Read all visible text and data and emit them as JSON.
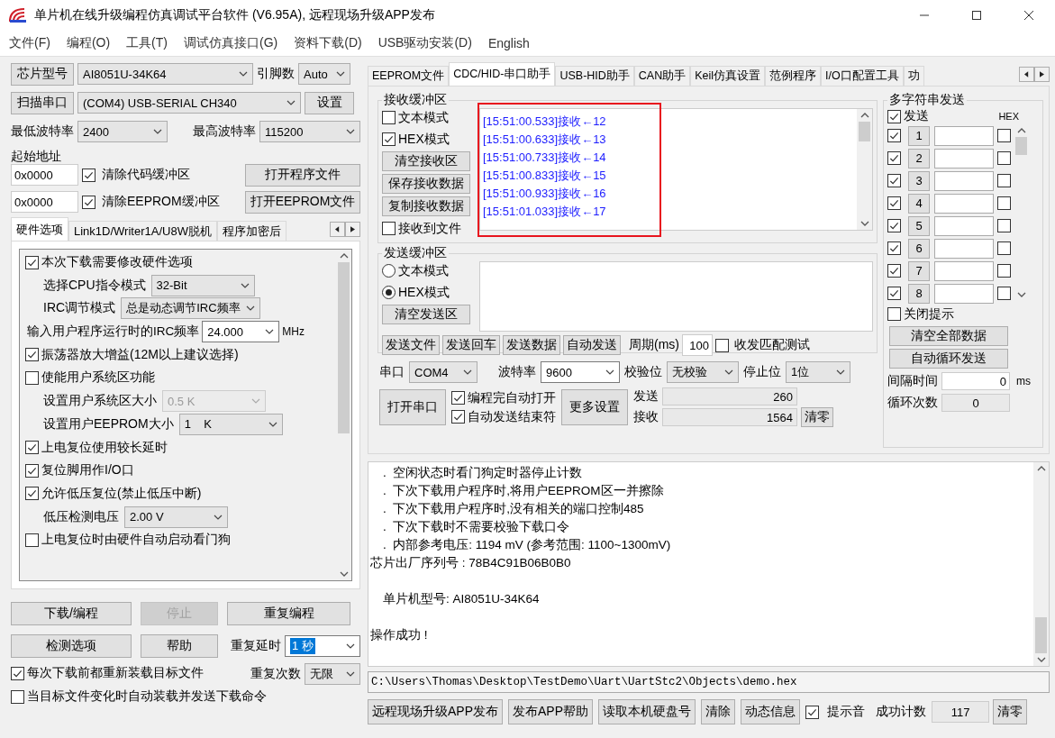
{
  "window": {
    "title": "单片机在线升级编程仿真调试平台软件 (V6.95A), 远程现场升级APP发布"
  },
  "menu": [
    "文件(F)",
    "编程(O)",
    "工具(T)",
    "调试仿真接口(G)",
    "资料下载(D)",
    "USB驱动安装(D)",
    "English"
  ],
  "chip": {
    "button": "芯片型号",
    "value": "AI8051U-34K64",
    "pins_label": "引脚数",
    "pins_value": "Auto"
  },
  "port": {
    "button": "扫描串口",
    "value": "(COM4) USB-SERIAL CH340",
    "settings_button": "设置"
  },
  "baud": {
    "min_label": "最低波特率",
    "min_value": "2400",
    "max_label": "最高波特率",
    "max_value": "115200"
  },
  "start_address": {
    "label": "起始地址",
    "rows": [
      {
        "value": "0x0000",
        "option": "清除代码缓冲区",
        "checked": true,
        "button": "打开程序文件"
      },
      {
        "value": "0x0000",
        "option": "清除EEPROM缓冲区",
        "checked": true,
        "button": "打开EEPROM文件"
      }
    ]
  },
  "left_tabs": [
    {
      "label": "硬件选项",
      "selected": true
    },
    {
      "label": "Link1D/Writer1A/U8W脱机",
      "selected": false
    },
    {
      "label": "程序加密后",
      "selected": false
    }
  ],
  "hardware_options": [
    {
      "kind": "checkbox",
      "label": "本次下载需要修改硬件选项",
      "checked": true
    },
    {
      "kind": "select",
      "label": "选择CPU指令模式",
      "value": "32-Bit",
      "disabled": false
    },
    {
      "kind": "select",
      "label": "IRC调节模式",
      "value": "总是动态调节IRC频率",
      "disabled": false
    },
    {
      "kind": "combo",
      "label": "输入用户程序运行时的IRC频率",
      "value": "24.000",
      "unit": "MHz"
    },
    {
      "kind": "checkbox",
      "label": "振荡器放大增益(12M以上建议选择)",
      "checked": true
    },
    {
      "kind": "checkbox",
      "label": "使能用户系统区功能",
      "checked": false
    },
    {
      "kind": "select",
      "label": "设置用户系统区大小",
      "value": "0.5 K",
      "disabled": true
    },
    {
      "kind": "select",
      "label": "设置用户EEPROM大小",
      "value": "1    K",
      "disabled": false
    },
    {
      "kind": "checkbox",
      "label": "上电复位使用较长延时",
      "checked": true
    },
    {
      "kind": "checkbox",
      "label": "复位脚用作I/O口",
      "checked": true
    },
    {
      "kind": "checkbox",
      "label": "允许低压复位(禁止低压中断)",
      "checked": true
    },
    {
      "kind": "select",
      "label": "低压检测电压",
      "value": "2.00 V",
      "disabled": false
    },
    {
      "kind": "checkbox",
      "label": "上电复位时由硬件自动启动看门狗",
      "checked": false
    }
  ],
  "actions": [
    {
      "label": "下载/编程",
      "disabled": false
    },
    {
      "label": "停止",
      "disabled": true
    },
    {
      "label": "重复编程",
      "disabled": false
    },
    {
      "label": "检测选项",
      "disabled": false
    },
    {
      "label": "帮助",
      "disabled": false
    }
  ],
  "repeat_delay": {
    "label": "重复延时",
    "value": "1 秒",
    "highlighted": true
  },
  "repeat_count": {
    "label": "重复次数",
    "value": "无限"
  },
  "bottom_options": [
    {
      "label": "每次下载前都重新装载目标文件",
      "checked": true
    },
    {
      "label": "当目标文件变化时自动装载并发送下载命令",
      "checked": false
    }
  ],
  "right_tabs": [
    {
      "label": "EEPROM文件",
      "selected": false
    },
    {
      "label": "CDC/HID-串口助手",
      "selected": true
    },
    {
      "label": "USB-HID助手",
      "selected": false
    },
    {
      "label": "CAN助手",
      "selected": false
    },
    {
      "label": "Keil仿真设置",
      "selected": false
    },
    {
      "label": "范例程序",
      "selected": false
    },
    {
      "label": "I/O口配置工具",
      "selected": false
    },
    {
      "label": "功",
      "selected": false
    }
  ],
  "receive": {
    "title": "接收缓冲区",
    "modes": [
      {
        "label": "文本模式",
        "checked": false
      },
      {
        "label": "HEX模式",
        "checked": true
      }
    ],
    "buttons": [
      "清空接收区",
      "保存接收数据",
      "复制接收数据"
    ],
    "to_file": {
      "label": "接收到文件",
      "checked": false
    },
    "highlighted": true,
    "lines": [
      "[15:51:00.533]接收←12",
      "[15:51:00.633]接收←13",
      "[15:51:00.733]接收←14",
      "[15:51:00.833]接收←15",
      "[15:51:00.933]接收←16",
      "[15:51:01.033]接收←17"
    ]
  },
  "send": {
    "title": "发送缓冲区",
    "modes": [
      {
        "label": "文本模式",
        "selected": false
      },
      {
        "label": "HEX模式",
        "selected": true
      }
    ],
    "clear_button": "清空发送区",
    "buttons": [
      "发送文件",
      "发送回车",
      "发送数据",
      "自动发送"
    ],
    "period_label": "周期(ms)",
    "period_value": "100",
    "match_test": {
      "label": "收发匹配测试",
      "checked": false
    }
  },
  "serial": {
    "port_label": "串口",
    "port_value": "COM4",
    "baud_label": "波特率",
    "baud_value": "9600",
    "parity_label": "校验位",
    "parity_value": "无校验",
    "stop_label": "停止位",
    "stop_value": "1位",
    "open_button": "打开串口",
    "options": [
      {
        "label": "编程完自动打开",
        "checked": true
      },
      {
        "label": "自动发送结束符",
        "checked": true
      }
    ],
    "more_button": "更多设置",
    "sent_label": "发送",
    "sent_value": "260",
    "received_label": "接收",
    "received_value": "1564",
    "clear_button": "清零"
  },
  "multi_send": {
    "title": "多字符串发送",
    "send": {
      "label": "发送",
      "checked": true
    },
    "hex_label": "HEX",
    "rows": [
      {
        "number": "1",
        "checked": true,
        "hex": false
      },
      {
        "number": "2",
        "checked": true,
        "hex": false
      },
      {
        "number": "3",
        "checked": true,
        "hex": false
      },
      {
        "number": "4",
        "checked": true,
        "hex": false
      },
      {
        "number": "5",
        "checked": true,
        "hex": false
      },
      {
        "number": "6",
        "checked": true,
        "hex": false
      },
      {
        "number": "7",
        "checked": true,
        "hex": false
      },
      {
        "number": "8",
        "checked": true,
        "hex": false
      }
    ],
    "close_hint": {
      "label": "关闭提示",
      "checked": false
    },
    "buttons": [
      "清空全部数据",
      "自动循环发送"
    ],
    "interval_label": "间隔时间",
    "interval_value": "0",
    "interval_unit": "ms",
    "loop_label": "循环次数",
    "loop_value": "0"
  },
  "output": {
    "lines": [
      {
        "text": ".  空闲状态时看门狗定时器停止计数",
        "indent": true,
        "gap_before": false
      },
      {
        "text": ".  下次下载用户程序时,将用户EEPROM区一并擦除",
        "indent": true,
        "gap_before": false
      },
      {
        "text": ".  下次下载用户程序时,没有相关的端口控制485",
        "indent": true,
        "gap_before": false
      },
      {
        "text": ".  下次下载时不需要校验下载口令",
        "indent": true,
        "gap_before": false
      },
      {
        "text": ".  内部参考电压: 1194 mV (参考范围: 1100~1300mV)",
        "indent": true,
        "gap_before": false
      },
      {
        "text": "芯片出厂序列号 : 78B4C91B06B0B0",
        "indent": false,
        "gap_before": false
      },
      {
        "text": "单片机型号: AI8051U-34K64",
        "indent": true,
        "gap_before": true
      },
      {
        "text": "操作成功 !",
        "indent": false,
        "gap_before": true
      }
    ]
  },
  "file_path": "C:\\Users\\Thomas\\Desktop\\TestDemo\\Uart\\UartStc2\\Objects\\demo.hex",
  "footer": {
    "buttons": [
      "远程现场升级APP发布",
      "发布APP帮助",
      "读取本机硬盘号",
      "清除",
      "动态信息"
    ],
    "sound": {
      "label": "提示音",
      "checked": true
    },
    "count_label": "成功计数",
    "count_value": "117",
    "clear_button": "清零"
  }
}
